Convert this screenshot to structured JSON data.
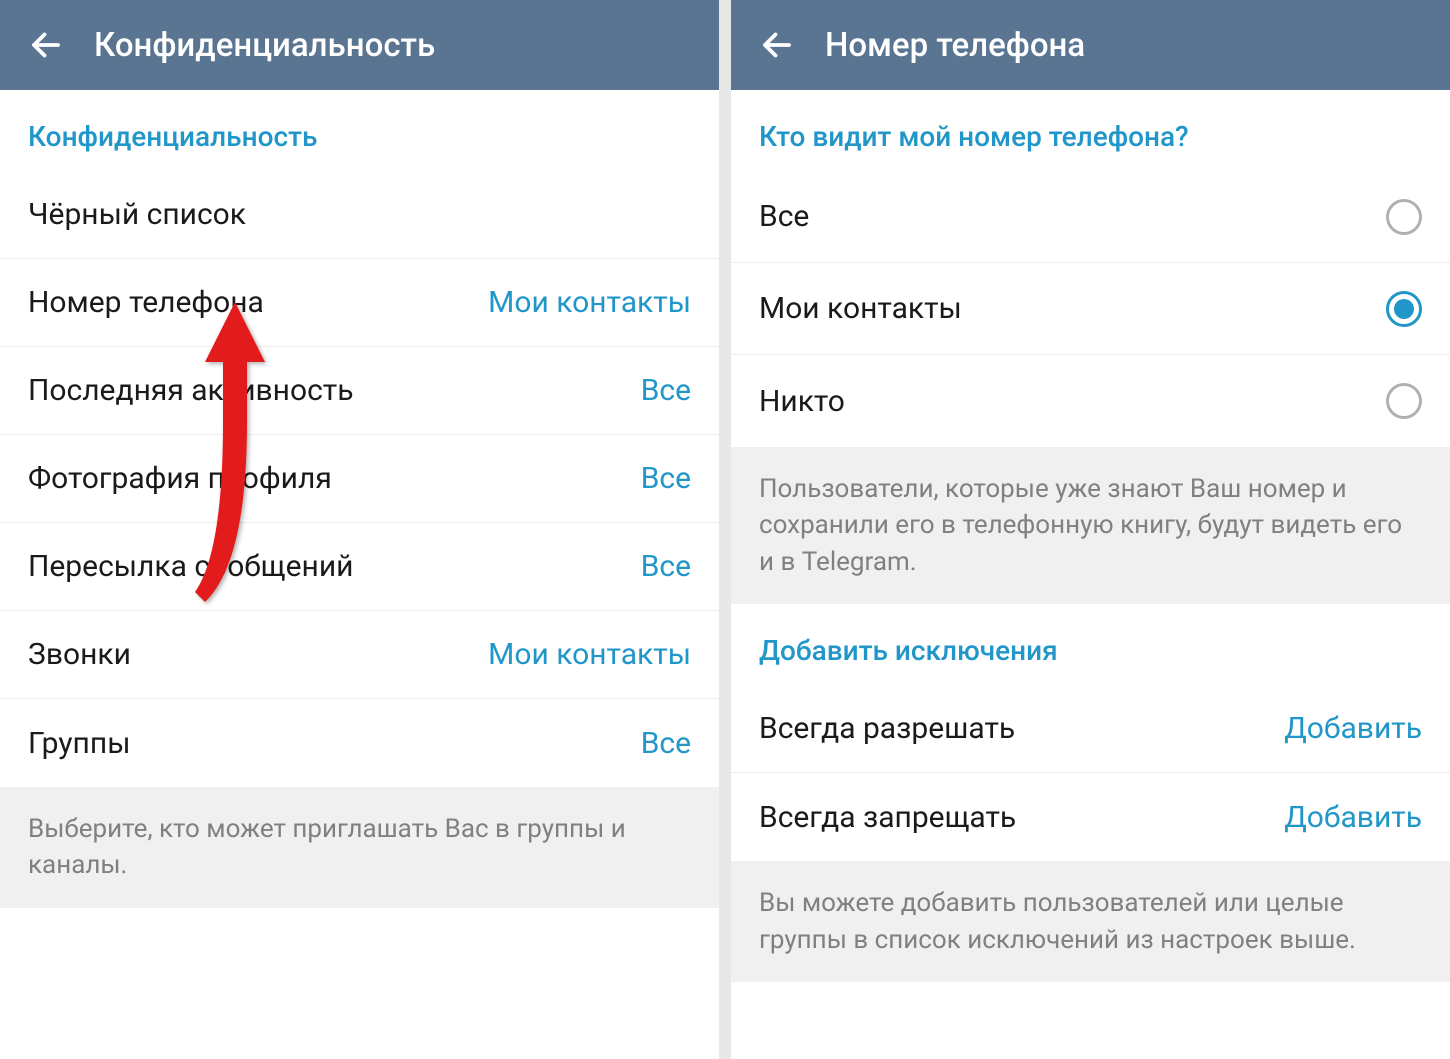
{
  "left": {
    "title": "Конфиденциальность",
    "section_header": "Конфиденциальность",
    "rows": [
      {
        "label": "Чёрный список",
        "value": ""
      },
      {
        "label": "Номер телефона",
        "value": "Мои контакты"
      },
      {
        "label": "Последняя активность",
        "value": "Все"
      },
      {
        "label": "Фотография профиля",
        "value": "Все"
      },
      {
        "label": "Пересылка сообщений",
        "value": "Все"
      },
      {
        "label": "Звонки",
        "value": "Мои контакты"
      },
      {
        "label": "Группы",
        "value": "Все"
      }
    ],
    "footer": "Выберите, кто может приглашать Вас в группы и каналы."
  },
  "right": {
    "title": "Номер телефона",
    "section_header": "Кто видит мой номер телефона?",
    "options": [
      {
        "label": "Все",
        "checked": false
      },
      {
        "label": "Мои контакты",
        "checked": true
      },
      {
        "label": "Никто",
        "checked": false
      }
    ],
    "info1": "Пользователи, которые уже знают Ваш номер и сохранили его в телефонную книгу, будут видеть его и в Telegram.",
    "exceptions_header": "Добавить исключения",
    "exception_rows": [
      {
        "label": "Всегда разрешать",
        "action": "Добавить"
      },
      {
        "label": "Всегда запрещать",
        "action": "Добавить"
      }
    ],
    "info2": "Вы можете добавить пользователей или целые группы в список исключений из настроек выше."
  }
}
